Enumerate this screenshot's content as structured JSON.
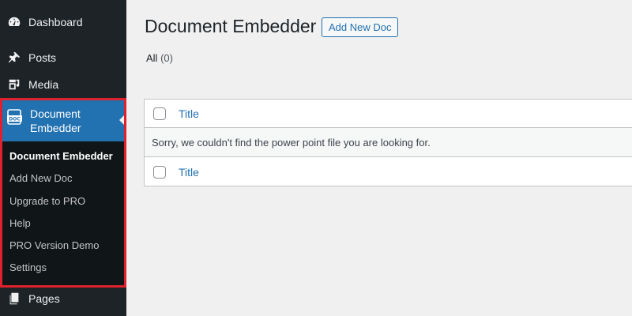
{
  "sidebar": {
    "items": [
      {
        "label": "Dashboard",
        "icon": "dashboard-icon"
      },
      {
        "label": "Posts",
        "icon": "pushpin-icon"
      },
      {
        "label": "Media",
        "icon": "media-icon"
      },
      {
        "label": "Pages",
        "icon": "pages-icon"
      }
    ],
    "active": {
      "label_line1": "Document",
      "label_line2": "Embedder",
      "icon": "doc-icon",
      "submenu": [
        "Document Embedder",
        "Add New Doc",
        "Upgrade to PRO",
        "Help",
        "PRO Version Demo",
        "Settings"
      ]
    }
  },
  "header": {
    "title": "Document Embedder",
    "add_new_label": "Add New Doc"
  },
  "views": {
    "all_label": "All",
    "all_count": "(0)"
  },
  "table": {
    "column_title": "Title",
    "empty_message": "Sorry, we couldn't find the power point file you are looking for."
  },
  "colors": {
    "sidebar_bg": "#1d2327",
    "accent": "#2271b1",
    "highlight_border": "#e0202c"
  }
}
